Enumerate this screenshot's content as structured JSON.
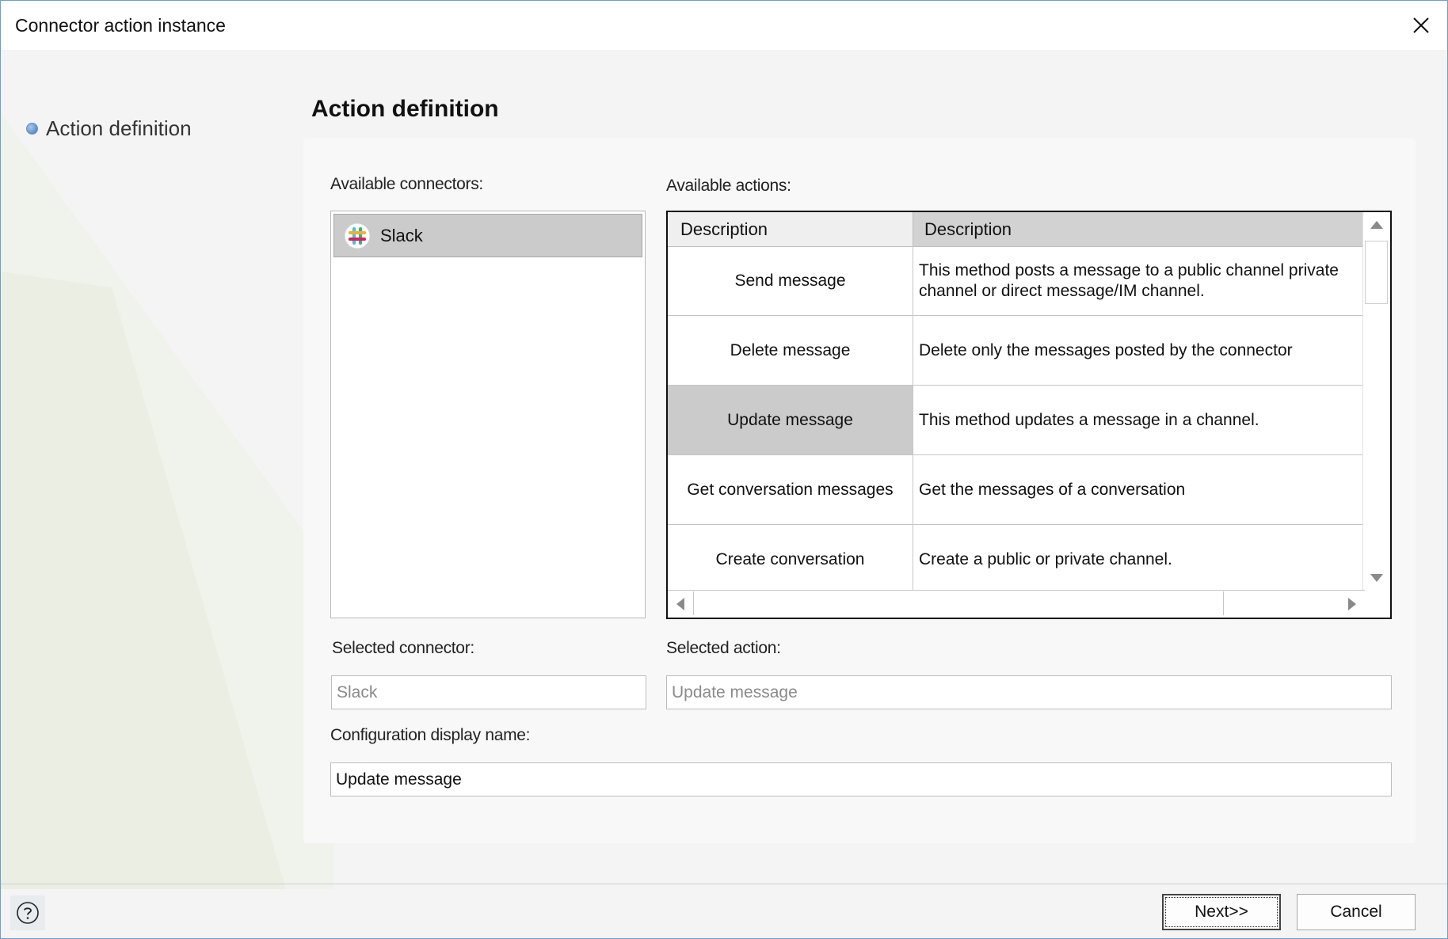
{
  "window": {
    "title": "Connector action instance"
  },
  "steps": [
    {
      "label": "Action definition"
    }
  ],
  "page": {
    "title": "Action definition"
  },
  "labels": {
    "available_connectors": "Available connectors:",
    "available_actions": "Available actions:",
    "selected_connector": "Selected connector:",
    "selected_action": "Selected action:",
    "config_display_name": "Configuration display name:"
  },
  "connectors": [
    {
      "name": "Slack",
      "icon": "slack-icon",
      "selected": true
    }
  ],
  "actions_grid": {
    "columns": [
      "Description",
      "Description"
    ],
    "rows": [
      {
        "name": "Send message",
        "description": "This method posts a message to a public channel private channel or direct message/IM channel.",
        "selected": false
      },
      {
        "name": "Delete message",
        "description": "Delete only the messages posted by the connector",
        "selected": false
      },
      {
        "name": "Update message",
        "description": "This method updates a message in a channel.",
        "selected": true
      },
      {
        "name": "Get conversation messages",
        "description": "Get the messages of a conversation",
        "selected": false
      },
      {
        "name": "Create conversation",
        "description": "Create a public or private channel.",
        "selected": false
      }
    ]
  },
  "fields": {
    "selected_connector": "Slack",
    "selected_action": "Update message",
    "config_display_name": "Update message"
  },
  "buttons": {
    "next": "Next>>",
    "cancel": "Cancel"
  },
  "colors": {
    "window_border": "#6f9dc9",
    "selection": "#cbcbcb",
    "step_dot": "#3d74bd"
  }
}
